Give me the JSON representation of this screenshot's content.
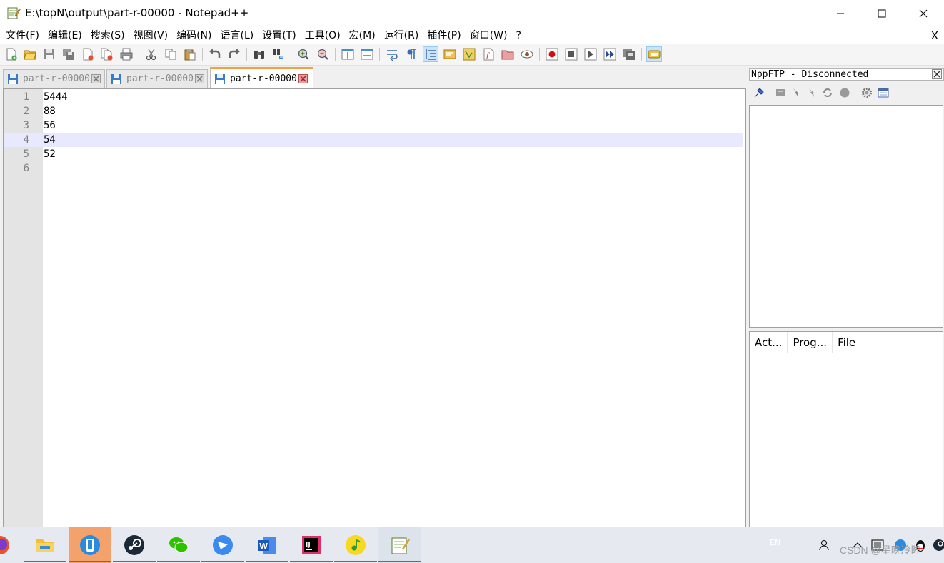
{
  "window": {
    "title": "E:\\topN\\output\\part-r-00000 - Notepad++",
    "controls": {
      "minimize": "—",
      "maximize": "☐",
      "close": "✕"
    }
  },
  "menu": {
    "items": [
      "文件(F)",
      "编辑(E)",
      "搜索(S)",
      "视图(V)",
      "编码(N)",
      "语言(L)",
      "设置(T)",
      "工具(O)",
      "宏(M)",
      "运行(R)",
      "插件(P)",
      "窗口(W)",
      "?"
    ],
    "close_doc": "X"
  },
  "toolbar": {
    "buttons": [
      "new-file",
      "open-file",
      "save",
      "save-all",
      "close",
      "close-all",
      "print",
      "cut",
      "copy",
      "paste",
      "undo",
      "redo",
      "find",
      "replace",
      "zoom-in",
      "zoom-out",
      "sync-vertical",
      "sync-horizontal",
      "word-wrap",
      "show-all-chars",
      "indent-guide",
      "user-defined-language",
      "document-map",
      "function-list",
      "folder-as-workspace",
      "monitoring",
      "macro-record",
      "macro-stop",
      "macro-play",
      "macro-run-multiple",
      "macro-save",
      "plugin-ftp"
    ],
    "active": [
      "indent-guide",
      "plugin-ftp"
    ]
  },
  "tabs": [
    {
      "label": "part-r-00000",
      "active": false
    },
    {
      "label": "part-r-00000",
      "active": false
    },
    {
      "label": "part-r-00000",
      "active": true
    }
  ],
  "editor": {
    "current_line": 4,
    "lines": [
      {
        "number": "1",
        "text": "5444"
      },
      {
        "number": "2",
        "text": "88"
      },
      {
        "number": "3",
        "text": "56"
      },
      {
        "number": "4",
        "text": "54"
      },
      {
        "number": "5",
        "text": "52"
      },
      {
        "number": "6",
        "text": ""
      }
    ]
  },
  "ftp_panel": {
    "title": "NppFTP - Disconnected",
    "queue_columns": [
      "Act...",
      "Prog...",
      "File"
    ]
  },
  "taskbar": {
    "apps": [
      "firefox",
      "file-explorer",
      "phone-link",
      "steam",
      "wechat",
      "feishu",
      "word",
      "intellij-idea",
      "music",
      "notepad-plus-plus"
    ],
    "tray_lang": "EN",
    "watermark": "CSDN @星晚冷眸"
  },
  "colors": {
    "current_line_bg": "#e8e8ff",
    "gutter_bg": "#e4e4e4",
    "active_tab_accent": "#f8a040",
    "taskbar_bg": "#e6eaf0"
  }
}
